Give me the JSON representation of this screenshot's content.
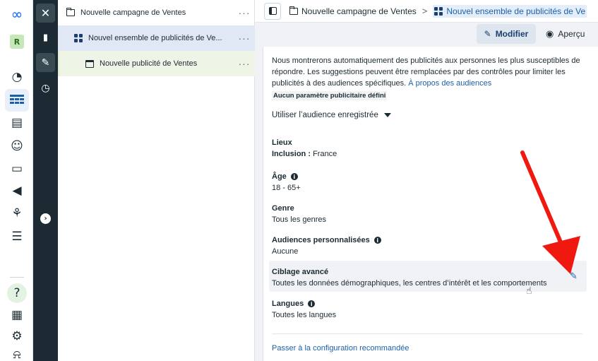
{
  "global_nav": {
    "avatar_letter": "R",
    "icons": [
      "meta-logo-icon",
      "avatar",
      "dashboard-icon",
      "campaigns-table-icon",
      "catalog-icon",
      "audiences-icon",
      "billing-icon",
      "advertise-icon",
      "connections-icon",
      "menu-icon",
      "help-icon",
      "news-icon",
      "settings-icon",
      "notifications-icon"
    ]
  },
  "rail": {
    "icons": [
      "close-icon",
      "chart-icon",
      "pencil-icon",
      "history-icon",
      "expand-icon"
    ]
  },
  "tree": {
    "campaign": {
      "label": "Nouvelle campagne de Ventes",
      "more": "···"
    },
    "adset": {
      "label": "Nouvel ensemble de publicités de Ve...",
      "more": "···"
    },
    "ad": {
      "label": "Nouvelle publicité de Ventes",
      "more": "···"
    }
  },
  "header": {
    "crumb_campaign": "Nouvelle campagne de Ventes",
    "crumb_separator": ">",
    "crumb_adset": "Nouvel ensemble de publicités de Ve"
  },
  "actions": {
    "edit_label": "Modifier",
    "preview_label": "Aperçu"
  },
  "audience": {
    "description": "Nous montrerons automatiquement des publicités aux personnes les plus susceptibles de répondre. Les suggestions peuvent être remplacées par des contrôles pour limiter les publicités à des audiences spécifiques.",
    "about_link": "À propos des audiences",
    "badge": "Aucun paramètre publicitaire défini",
    "saved_audience_dropdown": "Utiliser l’audience enregistrée",
    "fields": {
      "locations_title": "Lieux",
      "locations_label": "Inclusion :",
      "locations_value": "France",
      "age_title": "Âge",
      "age_value": "18 - 65+",
      "gender_title": "Genre",
      "gender_value": "Tous les genres",
      "custom_title": "Audiences personnalisées",
      "custom_value": "Aucune",
      "detailed_title": "Ciblage avancé",
      "detailed_value": "Toutes les données démographiques, les centres d’intérêt et les comportements",
      "languages_title": "Langues",
      "languages_value": "Toutes les langues"
    },
    "recommended_link": "Passer à la configuration recommandée"
  },
  "colors": {
    "accent": "#1c5fa8",
    "arrow": "#f0190f",
    "rail": "#1c2b33"
  }
}
